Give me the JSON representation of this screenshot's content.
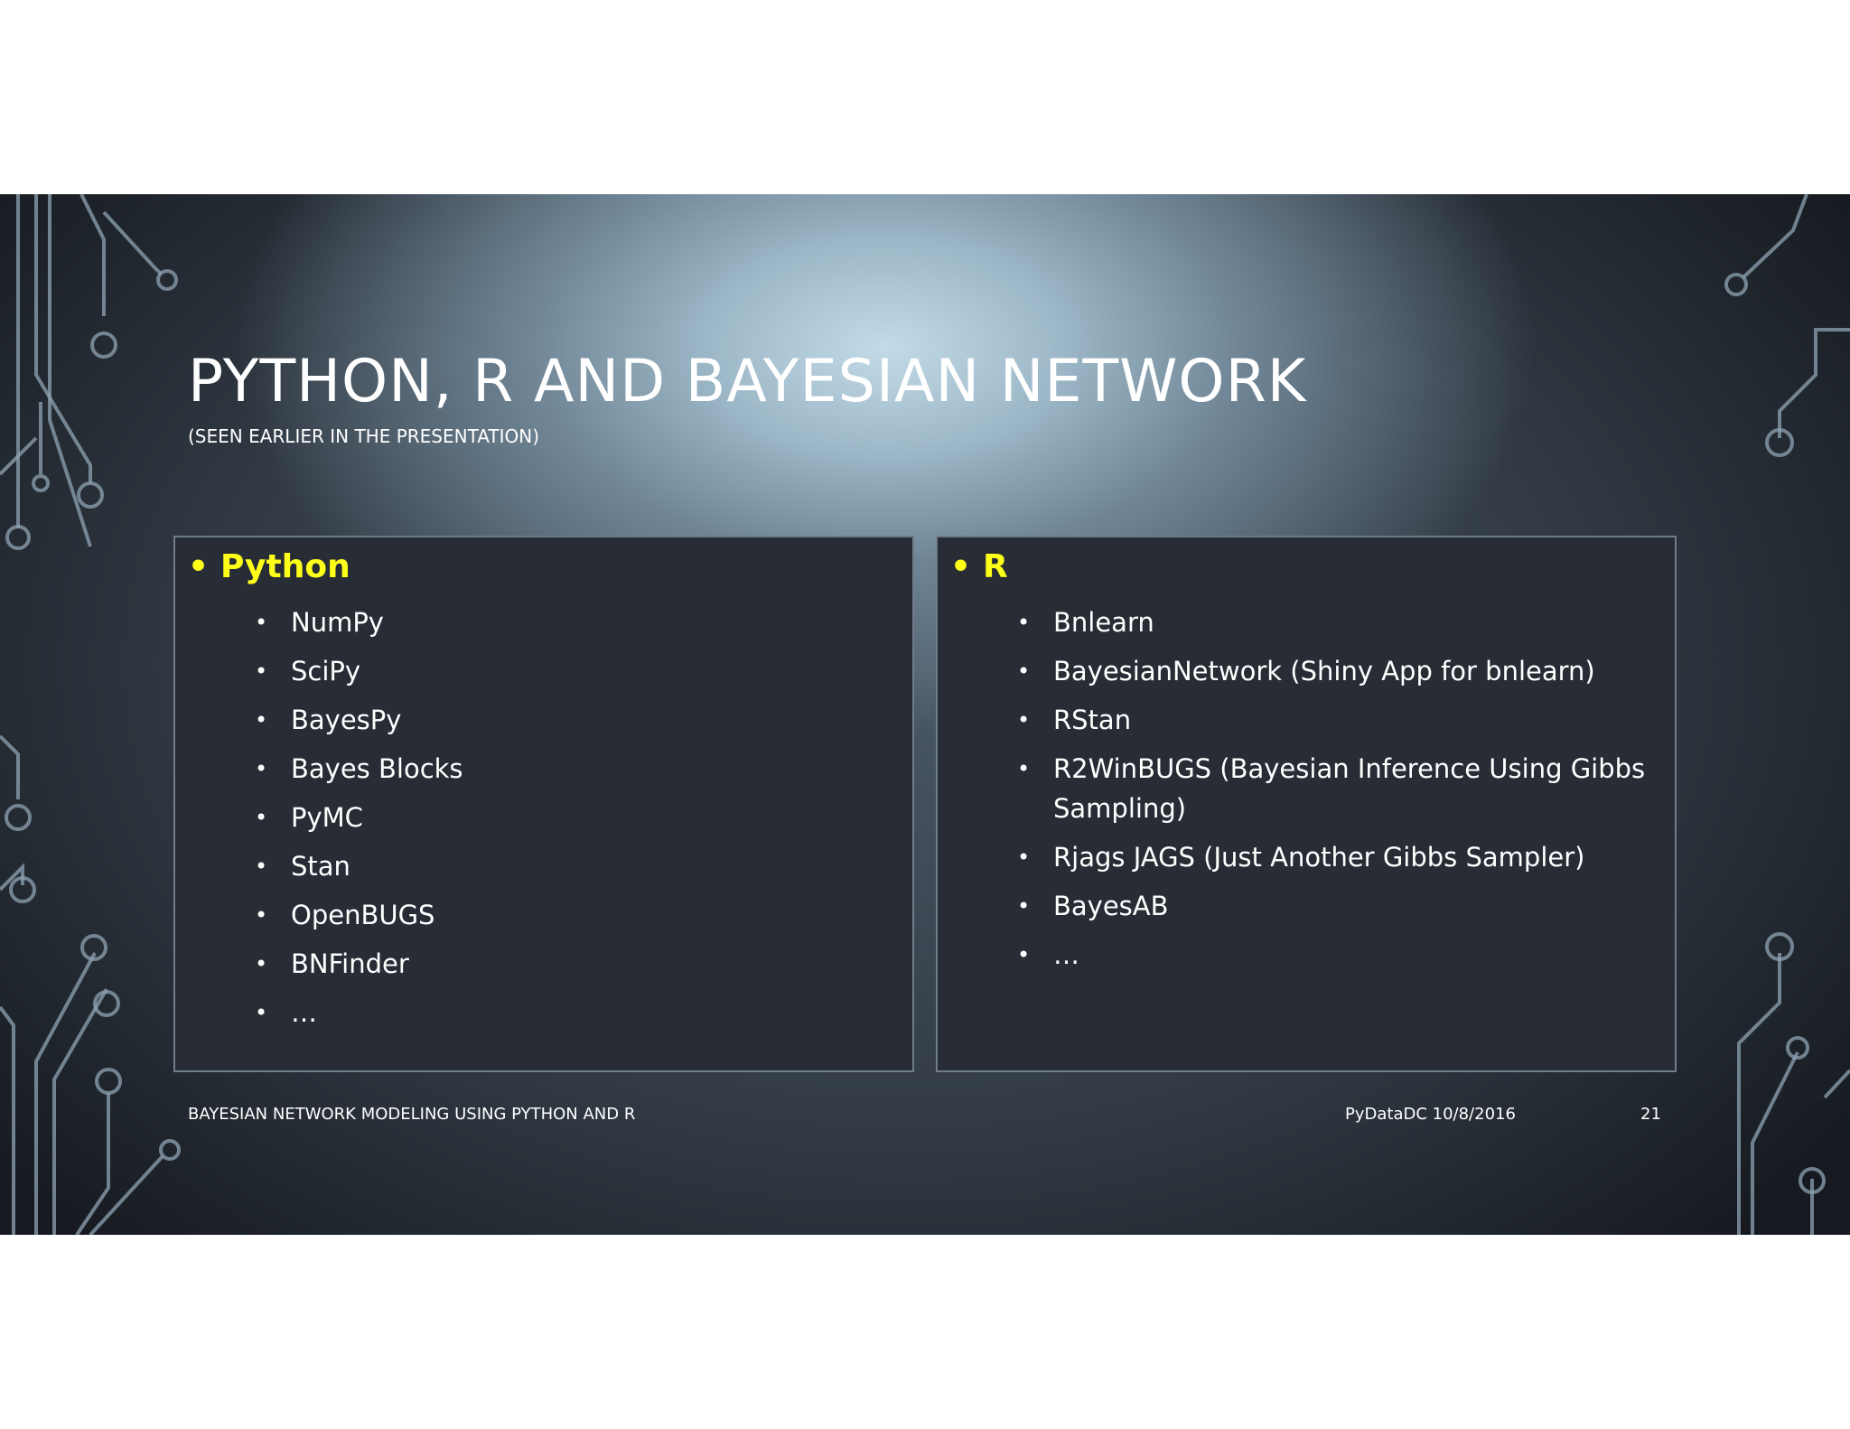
{
  "slide": {
    "title": "PYTHON, R AND BAYESIAN NETWORK",
    "subtitle": "(SEEN EARLIER IN THE PRESENTATION)",
    "bullet_glyph": "•",
    "left_panel": {
      "heading": "Python",
      "items": [
        "NumPy",
        "SciPy",
        "BayesPy",
        "Bayes Blocks",
        "PyMC",
        "Stan",
        "OpenBUGS",
        "BNFinder",
        "…"
      ]
    },
    "right_panel": {
      "heading": "R",
      "items": [
        "Bnlearn",
        "BayesianNetwork (Shiny App for bnlearn)",
        "RStan",
        "R2WinBUGS (Bayesian Inference Using Gibbs Sampling)",
        "Rjags JAGS (Just Another Gibbs Sampler)",
        "BayesAB",
        "…"
      ]
    },
    "footer": {
      "left": "BAYESIAN NETWORK MODELING USING PYTHON AND R",
      "event": "PyDataDC 10/8/2016",
      "page_number": "21"
    }
  },
  "colors": {
    "heading_accent": "#ffff1a",
    "panel_background": "#272c35",
    "text": "#ffffff",
    "circuit_lines": "#8fa3b3"
  }
}
